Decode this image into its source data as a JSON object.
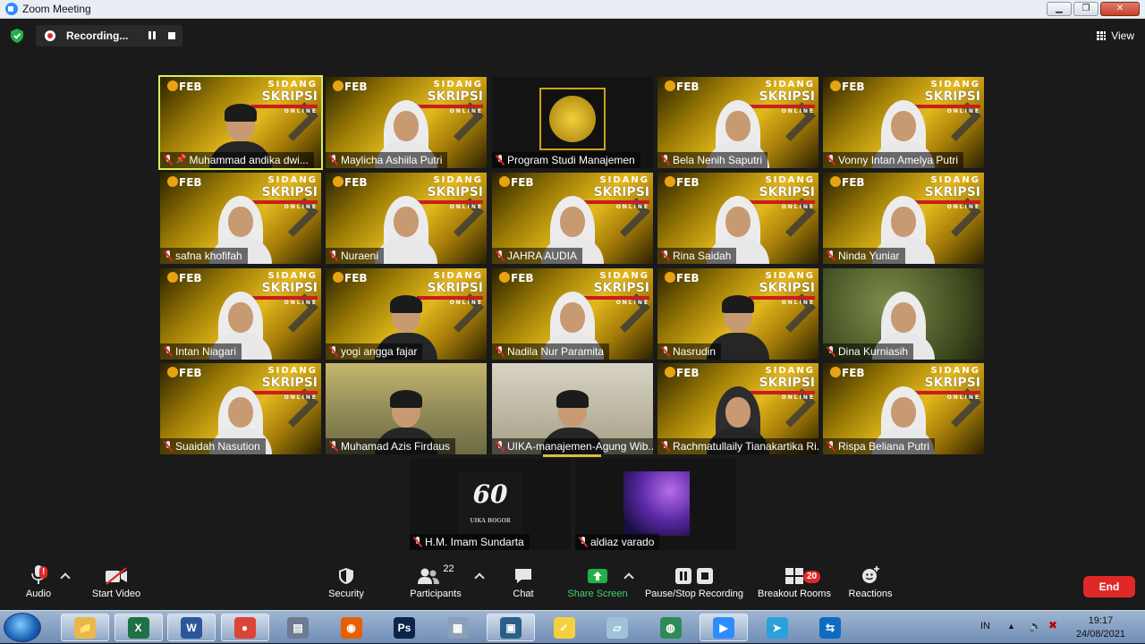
{
  "window": {
    "title": "Zoom Meeting",
    "controls": [
      "▁",
      "❐",
      "✕"
    ]
  },
  "recording": {
    "label": "Recording..."
  },
  "view": {
    "label": "View"
  },
  "participants_tiles": [
    {
      "name": "Muhammad andika dwi...",
      "bg": "feb",
      "person": "man",
      "active": true
    },
    {
      "name": "Maylicha Ashiila Putri",
      "bg": "feb",
      "person": "hijab-white"
    },
    {
      "name": "Program Studi Manajemen",
      "bg": "logo"
    },
    {
      "name": "Bela Nenih Saputri",
      "bg": "feb",
      "person": "hijab-white"
    },
    {
      "name": "Vonny Intan Amelya Putri",
      "bg": "feb",
      "person": "hijab-white"
    },
    {
      "name": "safna khofifah",
      "bg": "feb",
      "person": "hijab-white"
    },
    {
      "name": "Nuraeni",
      "bg": "feb",
      "person": "hijab-white"
    },
    {
      "name": "JAHRA AUDIA",
      "bg": "feb",
      "person": "hijab-white"
    },
    {
      "name": "Rina Saidah",
      "bg": "feb",
      "person": "hijab-white"
    },
    {
      "name": "Ninda Yuniar",
      "bg": "feb",
      "person": "hijab-white"
    },
    {
      "name": "Intan Niagari",
      "bg": "feb",
      "person": "hijab-white"
    },
    {
      "name": "yogi angga fajar",
      "bg": "feb",
      "person": "man"
    },
    {
      "name": "Nadila Nur Paramita",
      "bg": "feb",
      "person": "hijab-white"
    },
    {
      "name": "Nasrudin",
      "bg": "feb",
      "person": "man"
    },
    {
      "name": "Dina Kurniasih",
      "bg": "nature",
      "person": "hijab-white"
    },
    {
      "name": "Suaidah Nasution",
      "bg": "feb",
      "person": "hijab-white"
    },
    {
      "name": "Muhamad Azis Firdaus",
      "bg": "outdoor",
      "person": "man"
    },
    {
      "name": "UIKA-manajemen-Agung Wib...",
      "bg": "room",
      "person": "man"
    },
    {
      "name": "Rachmatullaily Tianakartika Ri...",
      "bg": "feb",
      "person": "hijab-dark"
    },
    {
      "name": "Rispa Beliana Putri",
      "bg": "feb",
      "person": "hijab-white"
    },
    {
      "name": "H.M. Imam Sundarta",
      "bg": "sixty"
    },
    {
      "name": "aldiaz varado",
      "bg": "purple"
    }
  ],
  "tile_branding": {
    "top": "SIDANG",
    "main": "SKRIPSI",
    "sub": "ONLINE",
    "logo": "FEB"
  },
  "logo60": {
    "number": "60",
    "caption": "UIKA BOGOR"
  },
  "toolbar": {
    "audio": "Audio",
    "start_video": "Start Video",
    "security": "Security",
    "participants": "Participants",
    "participants_count": "22",
    "chat": "Chat",
    "share_screen": "Share Screen",
    "pause_stop_recording": "Pause/Stop Recording",
    "breakout_rooms": "Breakout Rooms",
    "breakout_badge": "20",
    "reactions": "Reactions",
    "end": "End",
    "audio_alert": "!"
  },
  "taskbar": {
    "apps": [
      "explorer",
      "excel",
      "word",
      "chrome",
      "scanner",
      "firefox",
      "photoshop",
      "calculator",
      "media",
      "sticky",
      "notes",
      "globe",
      "zoom",
      "telegram",
      "teamviewer"
    ],
    "lang": "IN",
    "time": "19:17",
    "date": "24/08/2021"
  },
  "colors": {
    "active_speaker": "#d7ef5a",
    "end": "#e02828",
    "share": "#44d26a",
    "zoom_blue": "#2d8cff"
  }
}
